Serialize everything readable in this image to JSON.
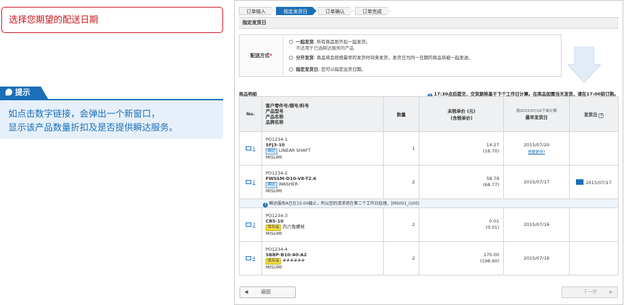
{
  "annotation": {
    "callout": "选择您期望的配送日期",
    "tip_label": "提示",
    "tip_line1": "如点击数字链接，会弹出一个新窗口，",
    "tip_line2": "显示该产品数量折扣及是否提供瞬达服务。"
  },
  "steps": [
    "订单输入",
    "指定发货日",
    "订单确认",
    "订单完成"
  ],
  "active_step": "指定发货日",
  "section_title": "指定发货日",
  "method": {
    "label": "配送方式",
    "required_mark": "*",
    "options": [
      {
        "name": "一起发货",
        "desc": "所有商品到齐后一起发货。",
        "sub": "不适用于已选瞬达服务的产品"
      },
      {
        "name": "分开发货",
        "desc": "商品将会按按最早的发货时间来发货，发货日为同一日期的商品将被一起发送。",
        "sub": ""
      },
      {
        "name": "指定发货日",
        "desc": "您可以指定出货日期。",
        "sub": ""
      }
    ]
  },
  "table": {
    "label": "商品明细",
    "note": "17:30点后提交，交货期将基于下个工作日计算。在库品如需当天发货，请在17:00前订购。",
    "headers": {
      "no": "No.",
      "product_lines": [
        "客户零件号/辑号/料号",
        "产品型号",
        "产品名称",
        "品牌名称"
      ],
      "qty": "数量",
      "price_line1": "未税单价 (元)",
      "price_line2": "(含税单价)",
      "earliest_small": "按2015/07/16下单计算",
      "earliest": "最早发货日",
      "ship": "发货日",
      "help": "?"
    },
    "rows": [
      {
        "no": "1",
        "code": "PO1234-1",
        "model": "SFJ3-10",
        "badge": "瞬达",
        "badge_type": "blue",
        "name": "LINEAR SHAFT",
        "brand": "MISUMI",
        "qty": "1",
        "price": "14.27",
        "price_tax": "(16.70)",
        "earliest": "2015/07/20",
        "change": "想要更快?",
        "ship": ""
      },
      {
        "no": "2",
        "code": "PO1234-2",
        "model": "FWSSM-D10-V8-T2.6",
        "badge": "瞬达",
        "badge_type": "blue",
        "name": "WASHER",
        "brand": "MISUMI",
        "qty": "2",
        "price": "58.78",
        "price_tax": "(68.77)",
        "earliest": "2015/07/17",
        "change": "",
        "ship": "2015/07/17"
      },
      {
        "no": "3",
        "code": "PO1234-3",
        "model": "CB5-10",
        "badge": "库存品",
        "badge_type": "yellow",
        "name": "内六角螺栓",
        "brand": "MISUMI",
        "qty": "2",
        "price": "0.01",
        "price_tax": "(0.01)",
        "earliest": "2015/07/16",
        "change": "",
        "ship": ""
      },
      {
        "no": "4",
        "code": "PO1234-4",
        "model": "SBBP-B10-40-A2",
        "badge": "库存品",
        "badge_type": "yellow",
        "name": "######",
        "brand": "MISUMI",
        "qty": "2",
        "price": "170.00",
        "price_tax": "(198.90)",
        "earliest": "2015/07/16",
        "change": "",
        "ship": ""
      }
    ],
    "notice": "瞬达服务A已在15:00截止，所以您的请求将在第二个工作日处理。[MS001_I100]"
  },
  "buttons": {
    "back": "返回",
    "next": "下一步"
  }
}
